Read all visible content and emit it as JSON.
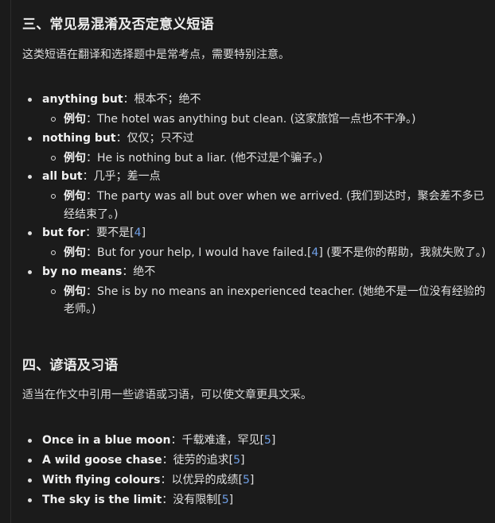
{
  "section3": {
    "title": "三、常见易混淆及否定意义短语",
    "intro": "这类短语在翻译和选择题中是常考点，需要特别注意。",
    "items": [
      {
        "term": "anything but",
        "meaning": "：根本不；绝不",
        "example_label": "例句",
        "example_text": "：The hotel was anything but clean. (这家旅馆一点也不干净。)"
      },
      {
        "term": "nothing but",
        "meaning": "：仅仅；只不过",
        "example_label": "例句",
        "example_text": "：He is nothing but a liar. (他不过是个骗子。)"
      },
      {
        "term": "all but",
        "meaning": "：几乎；差一点",
        "example_label": "例句",
        "example_text": "：The party was all but over when we arrived. (我们到达时，聚会差不多已经结束了。)"
      },
      {
        "term": "but for",
        "meaning": "：要不是",
        "meaning_cite": "4",
        "example_label": "例句",
        "example_text": "：But for your help, I would have failed.",
        "example_cite": "4",
        "example_tail": " (要不是你的帮助，我就失败了。)"
      },
      {
        "term": "by no means",
        "meaning": "：绝不",
        "example_label": "例句",
        "example_text": "：She is by no means an inexperienced teacher. (她绝不是一位没有经验的老师。)"
      }
    ]
  },
  "section4": {
    "title": "四、谚语及习语",
    "intro": "适当在作文中引用一些谚语或习语，可以使文章更具文采。",
    "items": [
      {
        "term": "Once in a blue moon",
        "meaning": "：千载难逢，罕见",
        "cite": "5"
      },
      {
        "term": "A wild goose chase",
        "meaning": "：徒劳的追求",
        "cite": "5"
      },
      {
        "term": "With flying colours",
        "meaning": "：以优异的成绩",
        "cite": "5"
      },
      {
        "term": "The sky is the limit",
        "meaning": "：没有限制",
        "cite": "5"
      }
    ]
  },
  "colors": {
    "background": "#1b1b1b",
    "text": "#e0e0e0",
    "citation_link": "#6f9fe6"
  }
}
